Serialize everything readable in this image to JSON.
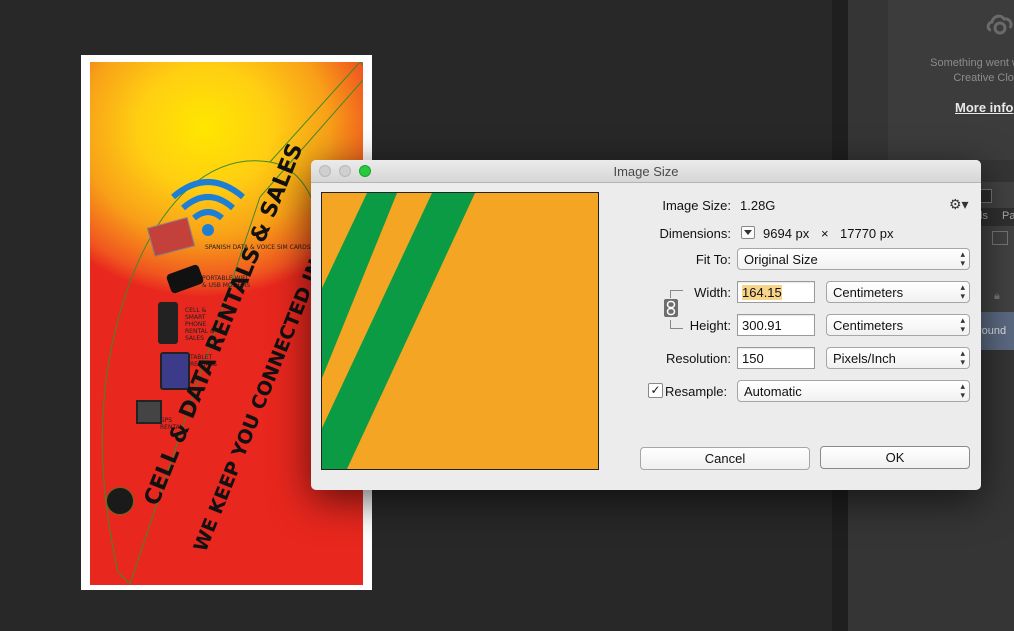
{
  "dialog": {
    "title": "Image Size",
    "image_size_label": "Image Size:",
    "image_size_value": "1.28G",
    "dimensions_label": "Dimensions:",
    "dimensions_width": "9694 px",
    "dimensions_times": "×",
    "dimensions_height": "17770 px",
    "fit_to_label": "Fit To:",
    "fit_to_value": "Original Size",
    "width_label": "Width:",
    "width_value": "164.15",
    "width_unit": "Centimeters",
    "height_label": "Height:",
    "height_value": "300.91",
    "height_unit": "Centimeters",
    "resolution_label": "Resolution:",
    "resolution_value": "150",
    "resolution_unit": "Pixels/Inch",
    "resample_label": "Resample:",
    "resample_checked": true,
    "resample_value": "Automatic",
    "cancel_label": "Cancel",
    "ok_label": "OK"
  },
  "creative_cloud": {
    "message_line1": "Something went w",
    "message_line2": "Creative Clou",
    "more_info": "More info"
  },
  "layers": {
    "tab_partial_1": "ls",
    "tab_partial_2": "Pa",
    "selected_layer_partial": "round"
  },
  "artwork": {
    "line1": "CELL & DATA RENTALS & SALES",
    "line2": "WE KEEP YOU CONNECTED IN SPAIN",
    "items": [
      "SPANISH DATA & VOICE SIM CARDS",
      "PORTABLE WIFI & USB MODEMS",
      "CELL & SMART PHONE RENTAL & SALES",
      "TABLET RENTALS",
      "GPS RENTAL"
    ]
  },
  "colors": {
    "preview_orange": "#f3a523",
    "preview_stripe": "#0b9b45",
    "zoom_light": "#27c93f",
    "selection_highlight": "#f7d489"
  }
}
